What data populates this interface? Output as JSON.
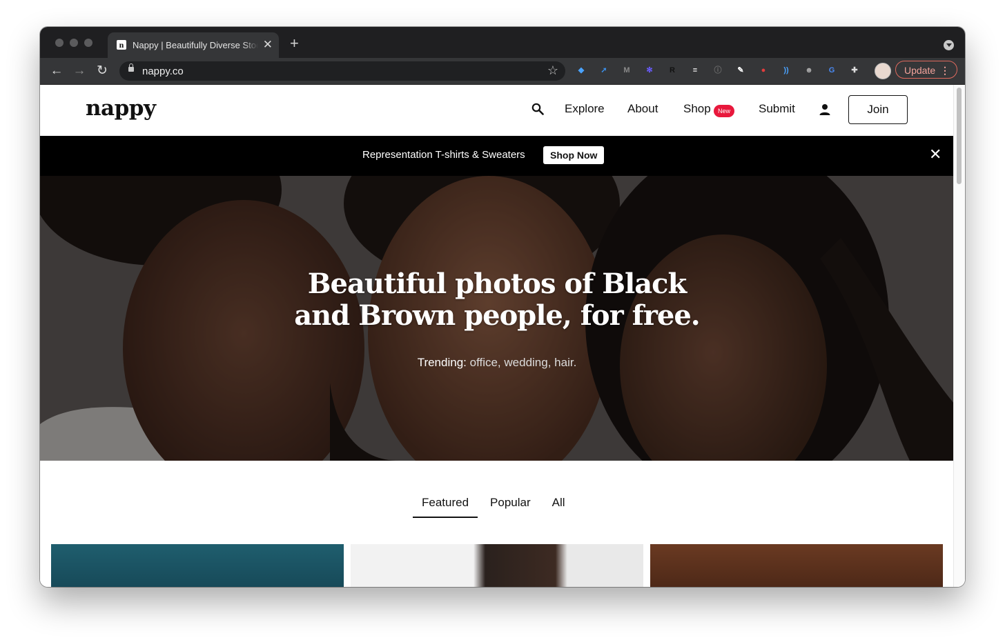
{
  "browser": {
    "tab_title": "Nappy | Beautifully Diverse Stock Photos",
    "tab_favicon": "n",
    "tab_close": "✕",
    "new_tab": "+",
    "url": "nappy.co",
    "update_label": "Update",
    "update_menu": "⋮",
    "back": "←",
    "forward": "→",
    "reload": "↻",
    "bookmark": "☆",
    "extensions": [
      {
        "name": "diamond-ext-icon",
        "color": "#4aa3ff",
        "glyph": "◆"
      },
      {
        "name": "share-ext-icon",
        "color": "#3b8ee8",
        "glyph": "➚"
      },
      {
        "name": "m-ext-icon",
        "color": "#8a8a8a",
        "glyph": "M"
      },
      {
        "name": "snowflake-ext-icon",
        "color": "#6a5cff",
        "glyph": "✻"
      },
      {
        "name": "r-ext-icon",
        "color": "#111111",
        "glyph": "R"
      },
      {
        "name": "notes-ext-icon",
        "color": "#ffffff",
        "glyph": "≡"
      },
      {
        "name": "info-ext-icon",
        "color": "#6a6a6a",
        "glyph": "ⓘ"
      },
      {
        "name": "edit-ext-icon",
        "color": "#ffffff",
        "glyph": "✎"
      },
      {
        "name": "pokeball-ext-icon",
        "color": "#e23d3d",
        "glyph": "●"
      },
      {
        "name": "cast-ext-icon",
        "color": "#4aa3ff",
        "glyph": "))"
      },
      {
        "name": "monkey-ext-icon",
        "color": "#aaaaaa",
        "glyph": "☻"
      },
      {
        "name": "translate-ext-icon",
        "color": "#4a8af4",
        "glyph": "G"
      },
      {
        "name": "puzzle-ext-icon",
        "color": "#dddddd",
        "glyph": "✚"
      }
    ]
  },
  "site": {
    "logo": "nappy",
    "nav": {
      "explore": "Explore",
      "about": "About",
      "shop": "Shop",
      "shop_badge": "New",
      "submit": "Submit",
      "join": "Join"
    },
    "promo": {
      "text": "Representation T-shirts & Sweaters",
      "button": "Shop Now",
      "close": "✕"
    },
    "hero": {
      "title_line1": "Beautiful photos of Black",
      "title_line2": "and Brown people, for free.",
      "trending_label": "Trending:",
      "trending_links": "office, wedding, hair."
    },
    "tabs": [
      "Featured",
      "Popular",
      "All"
    ],
    "active_tab": "Featured"
  }
}
